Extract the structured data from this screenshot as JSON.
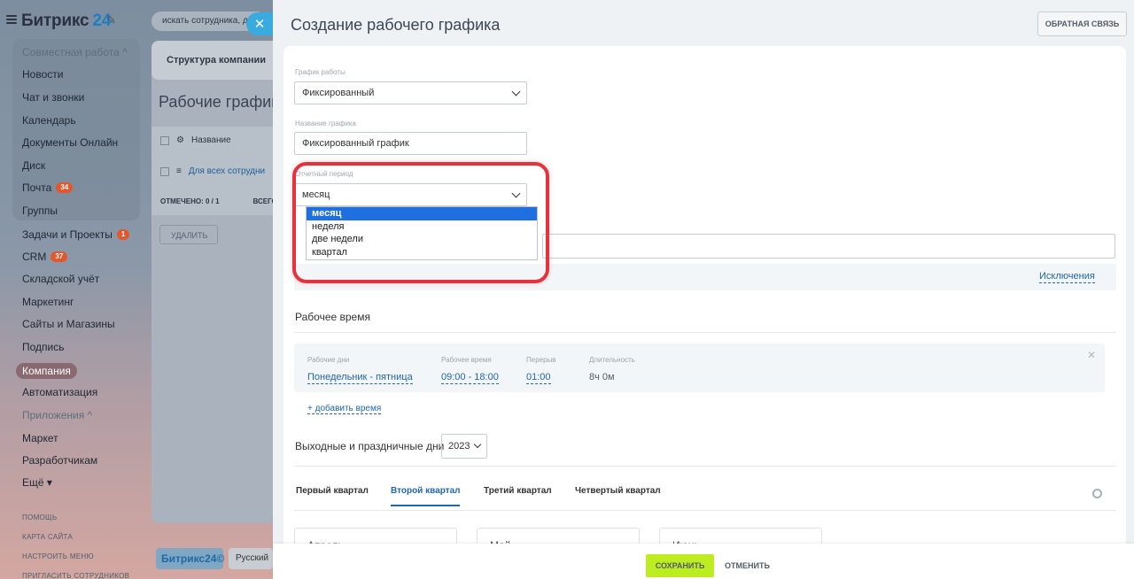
{
  "app": {
    "logo_text": "Битрикс",
    "logo_num": "24",
    "search_placeholder": "искать сотрудника, д",
    "sidebar": {
      "group_label": "Совместная работа ^",
      "items": [
        {
          "label": "Новости"
        },
        {
          "label": "Чат и звонки"
        },
        {
          "label": "Календарь"
        },
        {
          "label": "Документы Онлайн"
        },
        {
          "label": "Диск"
        },
        {
          "label": "Почта",
          "badge": "34"
        },
        {
          "label": "Группы"
        },
        {
          "label": "Задачи и Проекты",
          "badge": "1"
        },
        {
          "label": "CRM",
          "badge": "37"
        },
        {
          "label": "Складской учёт"
        },
        {
          "label": "Маркетинг"
        },
        {
          "label": "Сайты и Магазины"
        },
        {
          "label": "Подпись"
        },
        {
          "label": "Компания"
        },
        {
          "label": "Автоматизация"
        },
        {
          "label": "Приложения ^"
        },
        {
          "label": "Маркет"
        },
        {
          "label": "Разработчикам"
        },
        {
          "label": "Ещё ▾"
        }
      ],
      "footer_links": [
        "ПОМОЩЬ",
        "КАРТА САЙТА",
        "НАСТРОИТЬ МЕНЮ",
        "ПРИГЛАСИТЬ СОТРУДНИКОВ"
      ]
    },
    "content": {
      "tab_label": "Структура компании",
      "heading": "Рабочие график",
      "column_name": "Название",
      "row_link": "Для всех сотрудни",
      "marked": "ОТМЕЧЕНО: 0 / 1",
      "all_label": "ВСЕГО",
      "delete_button": "УДАЛИТЬ",
      "footer_logo": "Битрикс24©",
      "footer_lang": "Русский"
    }
  },
  "panel": {
    "title": "Создание рабочего графика",
    "feedback_button": "ОБРАТНАЯ СВЯЗЬ",
    "schedule_type": {
      "label": "График работы",
      "value": "Фиксированный"
    },
    "schedule_name": {
      "label": "Название графика",
      "value": "Фиксированный график"
    },
    "period": {
      "label": "Отчетный период",
      "value": "месяц",
      "options": [
        "месяц",
        "неделя",
        "две недели",
        "квартал"
      ]
    },
    "exceptions_link": "Исключения",
    "working_time": {
      "title": "Рабочее время",
      "days_label": "Рабочие дни",
      "days_value": "Понедельник - пятница",
      "hours_label": "Рабочее время",
      "hours_value": "09:00 - 18:00",
      "break_label": "Перерыв",
      "break_value": "01:00",
      "duration_label": "Длительность",
      "duration_value": "8ч 0м",
      "add_link": "+ добавить время"
    },
    "holidays": {
      "title": "Выходные и праздничные дни",
      "year": "2023"
    },
    "quarter_tabs": [
      "Первый квартал",
      "Второй квартал",
      "Третий квартал",
      "Четвертый квартал"
    ],
    "active_quarter_index": 1,
    "months": [
      "Апрель",
      "Май",
      "Июнь"
    ],
    "save_button": "СОХРАНИТЬ",
    "cancel_button": "ОТМЕНИТЬ"
  }
}
